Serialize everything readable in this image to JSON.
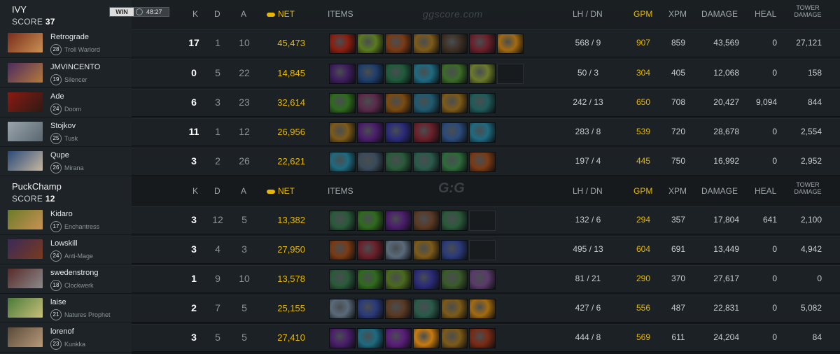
{
  "colors": {
    "gold": "#e8b800",
    "text": "#c7cdd0",
    "dim": "#8b9498"
  },
  "headers": {
    "k": "K",
    "d": "D",
    "a": "A",
    "net": "NET",
    "items": "ITEMS",
    "lhdn": "LH / DN",
    "gpm": "GPM",
    "xpm": "XPM",
    "damage": "DAMAGE",
    "heal": "HEAL",
    "tower": "TOWER DAMAGE"
  },
  "watermark": "ggscore.com",
  "watermark_logo": "G:G",
  "teams": [
    {
      "name": "IVY",
      "score_label": "SCORE",
      "score": "37",
      "result": "WIN",
      "duration": "48:27",
      "players": [
        {
          "name": "Retrograde",
          "level": "28",
          "hero": "Troll Warlord",
          "k": "17",
          "d": "1",
          "a": "10",
          "net": "45,473",
          "lhdn": "568 / 9",
          "gpm": "907",
          "xpm": "859",
          "damage": "43,569",
          "heal": "0",
          "tower": "27,121",
          "portrait": [
            "#7a2c1d",
            "#c99252"
          ],
          "items": [
            "#8b1e10",
            "#5a7a1d",
            "#7a3a14",
            "#7d5a18",
            "#3d2f24",
            "#6b1f2a",
            "#a36a10"
          ]
        },
        {
          "name": "JMVINCENTO",
          "level": "19",
          "hero": "Silencer",
          "k": "0",
          "d": "5",
          "a": "22",
          "net": "14,845",
          "lhdn": "50 / 3",
          "gpm": "304",
          "xpm": "405",
          "damage": "12,068",
          "heal": "0",
          "tower": "158",
          "portrait": [
            "#4d2b5e",
            "#b47a3b"
          ],
          "items": [
            "#3e1d5e",
            "#1f3e6b",
            "#1f5a3b",
            "#1e6a80",
            "#3c6b27",
            "#6b7a2a",
            "empty"
          ]
        },
        {
          "name": "Ade",
          "level": "24",
          "hero": "Doom",
          "k": "6",
          "d": "3",
          "a": "23",
          "net": "32,614",
          "lhdn": "242 / 13",
          "gpm": "650",
          "xpm": "708",
          "damage": "20,427",
          "heal": "9,094",
          "tower": "844",
          "portrait": [
            "#8a1a12",
            "#2e1a14"
          ],
          "items": [
            "#2f6a1d",
            "#5a2a4a",
            "#7a4a10",
            "#1f5a70",
            "#7d5a18",
            "#1f5a5a"
          ]
        },
        {
          "name": "Stojkov",
          "level": "25",
          "hero": "Tusk",
          "k": "11",
          "d": "1",
          "a": "12",
          "net": "26,956",
          "lhdn": "283 / 8",
          "gpm": "539",
          "xpm": "720",
          "damage": "28,678",
          "heal": "0",
          "tower": "2,554",
          "portrait": [
            "#9aa5ad",
            "#5a6770"
          ],
          "items": [
            "#7d5a18",
            "#4a1d6b",
            "#2a2a7a",
            "#6b1f2a",
            "#2a4a7a",
            "#1e6a80"
          ]
        },
        {
          "name": "Qupe",
          "level": "26",
          "hero": "Mirana",
          "k": "3",
          "d": "2",
          "a": "26",
          "net": "22,621",
          "lhdn": "197 / 4",
          "gpm": "445",
          "xpm": "750",
          "damage": "16,992",
          "heal": "0",
          "tower": "2,952",
          "portrait": [
            "#2a4a7a",
            "#c7b7a0"
          ],
          "items": [
            "#1e6a80",
            "#3a4a5a",
            "#2a5a3a",
            "#2a5a4a",
            "#2e6a3a",
            "#7a3a14"
          ]
        }
      ]
    },
    {
      "name": "PuckChamp",
      "score_label": "SCORE",
      "score": "12",
      "players": [
        {
          "name": "Kidaro",
          "level": "17",
          "hero": "Enchantress",
          "k": "3",
          "d": "12",
          "a": "5",
          "net": "13,382",
          "lhdn": "132 / 6",
          "gpm": "294",
          "xpm": "357",
          "damage": "17,804",
          "heal": "641",
          "tower": "2,100",
          "portrait": [
            "#6b7a2a",
            "#c99252"
          ],
          "items": [
            "#2a5a3a",
            "#2f6a1d",
            "#4a1d6b",
            "#5a3a24",
            "#2a5a3a",
            "empty"
          ]
        },
        {
          "name": "Lowskill",
          "level": "24",
          "hero": "Anti-Mage",
          "k": "3",
          "d": "4",
          "a": "3",
          "net": "27,950",
          "lhdn": "495 / 13",
          "gpm": "604",
          "xpm": "691",
          "damage": "13,449",
          "heal": "0",
          "tower": "4,942",
          "portrait": [
            "#3a2a5a",
            "#7a3a1d"
          ],
          "items": [
            "#7a3a14",
            "#6b1f2a",
            "#5a6a7a",
            "#7d5a18",
            "#2a3a7a",
            "empty"
          ]
        },
        {
          "name": "swedenstrong",
          "level": "18",
          "hero": "Clockwerk",
          "k": "1",
          "d": "9",
          "a": "10",
          "net": "13,578",
          "lhdn": "81 / 21",
          "gpm": "290",
          "xpm": "370",
          "damage": "27,617",
          "heal": "0",
          "tower": "0",
          "portrait": [
            "#5a2a2a",
            "#8a8a8a"
          ],
          "items": [
            "#2a5a3a",
            "#2f6a1d",
            "#4a6a1d",
            "#2a2a7a",
            "#3a5a2a",
            "#5a3a6a"
          ]
        },
        {
          "name": "laise",
          "level": "21",
          "hero": "Natures Prophet",
          "k": "2",
          "d": "7",
          "a": "5",
          "net": "25,155",
          "lhdn": "427 / 6",
          "gpm": "556",
          "xpm": "487",
          "damage": "22,831",
          "heal": "0",
          "tower": "5,082",
          "portrait": [
            "#4a7a3a",
            "#c9c07a"
          ],
          "items": [
            "#5a6a7a",
            "#2a3a7a",
            "#5a3a24",
            "#2a5a4a",
            "#7d5a18",
            "#a36a10"
          ]
        },
        {
          "name": "lorenof",
          "level": "23",
          "hero": "Kunkka",
          "k": "3",
          "d": "5",
          "a": "5",
          "net": "27,410",
          "lhdn": "444 / 8",
          "gpm": "569",
          "xpm": "611",
          "damage": "24,204",
          "heal": "0",
          "tower": "84",
          "portrait": [
            "#5a4a3a",
            "#b79a7a"
          ],
          "items": [
            "#4a1d6b",
            "#1e6a80",
            "#5a1d7a",
            "#c77a10",
            "#7d5a18",
            "#7a2a14"
          ]
        }
      ]
    }
  ]
}
